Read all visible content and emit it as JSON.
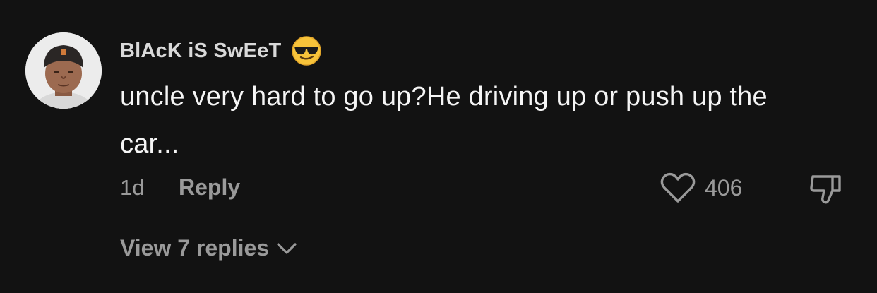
{
  "comment": {
    "username": "BlAcK iS SwEeT",
    "username_emoji": "sunglasses-emoji",
    "text": "uncle very hard to go up?He driving up or push up the car...",
    "timestamp": "1d",
    "reply_label": "Reply",
    "like_count": "406",
    "view_replies_label": "View 7 replies"
  },
  "icons": {
    "like": "heart-outline-icon",
    "dislike": "thumbs-down-icon",
    "expand": "chevron-down-icon"
  },
  "colors": {
    "background": "#121212",
    "primary_text": "#f5f5f5",
    "secondary_text": "#9a9a9a"
  }
}
